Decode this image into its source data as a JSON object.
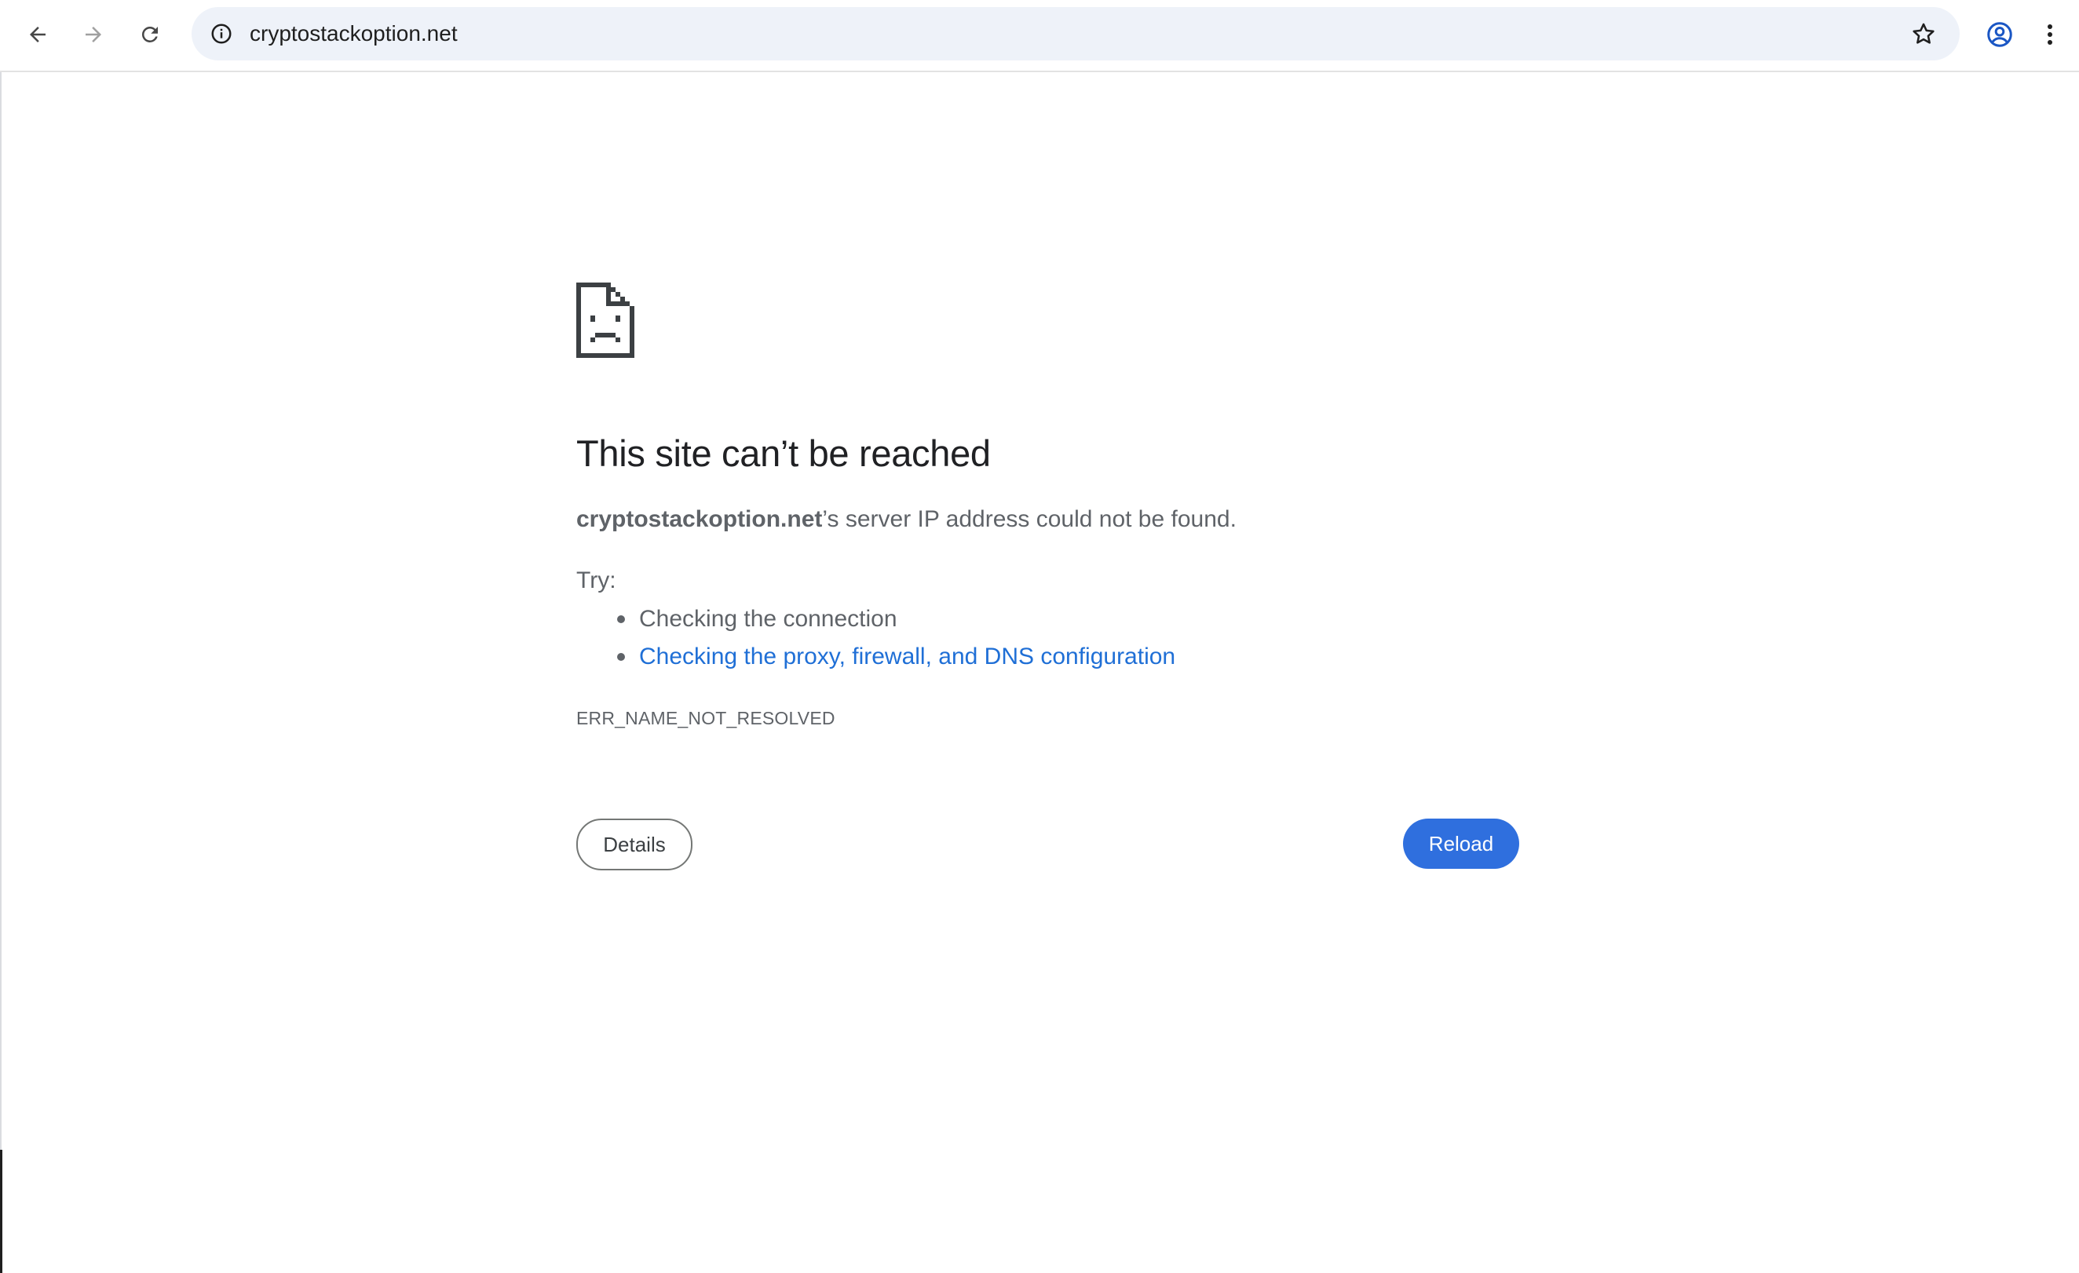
{
  "browser": {
    "url": "cryptostackoption.net",
    "icons": {
      "back": "arrow-left-icon",
      "forward": "arrow-right-icon",
      "reload": "reload-icon",
      "site_info": "info-icon",
      "bookmark": "star-icon",
      "profile": "account-circle-icon",
      "menu": "more-vertical-icon"
    }
  },
  "error_page": {
    "icon": "sad-page-icon",
    "headline": "This site can’t be reached",
    "domain": "cryptostackoption.net",
    "message_suffix": "’s server IP address could not be found.",
    "try_label": "Try:",
    "suggestions": [
      {
        "text": "Checking the connection",
        "is_link": false
      },
      {
        "text": "Checking the proxy, firewall, and DNS configuration",
        "is_link": true
      }
    ],
    "error_code": "ERR_NAME_NOT_RESOLVED",
    "details_button": "Details",
    "reload_button": "Reload"
  },
  "colors": {
    "link": "#1f6fd6",
    "primary_button": "#2f6fde",
    "omnibox_bg": "#eef2f9",
    "body_text": "#5f6368",
    "headline_text": "#202124"
  }
}
